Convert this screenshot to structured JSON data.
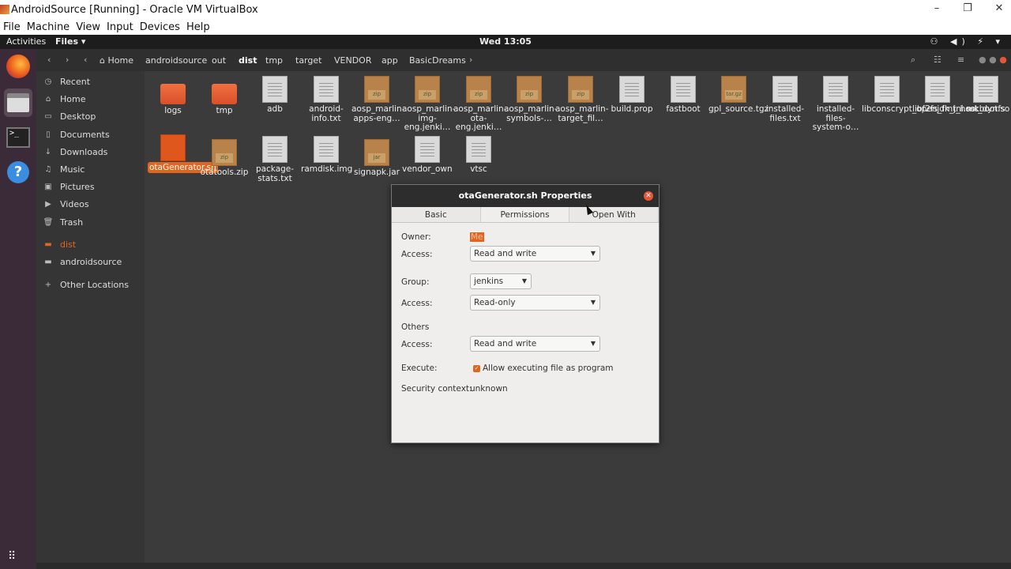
{
  "host": {
    "title": "AndroidSource [Running] - Oracle VM VirtualBox",
    "minimize": "–",
    "restore": "❐",
    "close": "✕",
    "menu": [
      "File",
      "Machine",
      "View",
      "Input",
      "Devices",
      "Help"
    ]
  },
  "topbar": {
    "activities": "Activities",
    "app_menu": "Files ▾",
    "clock": "Wed 13:05",
    "tray": "⚇ ◀) ⚡ ▾"
  },
  "sidebar": {
    "items": [
      {
        "icon": "clock-icon",
        "glyph": "◷",
        "label": "Recent"
      },
      {
        "icon": "home-icon",
        "glyph": "⌂",
        "label": "Home"
      },
      {
        "icon": "desktop-icon",
        "glyph": "▭",
        "label": "Desktop"
      },
      {
        "icon": "documents-icon",
        "glyph": "▯",
        "label": "Documents"
      },
      {
        "icon": "downloads-icon",
        "glyph": "↓",
        "label": "Downloads"
      },
      {
        "icon": "music-icon",
        "glyph": "♫",
        "label": "Music"
      },
      {
        "icon": "pictures-icon",
        "glyph": "▣",
        "label": "Pictures"
      },
      {
        "icon": "videos-icon",
        "glyph": "▶",
        "label": "Videos"
      },
      {
        "icon": "trash-icon",
        "glyph": "🗑",
        "label": "Trash"
      },
      {
        "icon": "folder-icon",
        "glyph": "▬",
        "label": "dist"
      },
      {
        "icon": "folder-icon",
        "glyph": "▬",
        "label": "androidsource"
      },
      {
        "icon": "plus-icon",
        "glyph": "+",
        "label": "Other Locations"
      }
    ]
  },
  "breadcrumb": [
    "Home",
    "androidsource",
    "out",
    "dist",
    "tmp",
    "target",
    "VENDOR",
    "app",
    "BasicDreams"
  ],
  "files": [
    {
      "name": "logs",
      "kind": "folder"
    },
    {
      "name": "tmp",
      "kind": "folder"
    },
    {
      "name": "adb",
      "kind": "doc"
    },
    {
      "name": "android-info.txt",
      "kind": "doc"
    },
    {
      "name": "aosp_marlin-apps-eng…",
      "kind": "pkg",
      "tag": "zip"
    },
    {
      "name": "aosp_marlin-img-eng.jenki…",
      "kind": "pkg",
      "tag": "zip"
    },
    {
      "name": "aosp_marlin-ota-eng.jenki…",
      "kind": "pkg",
      "tag": "zip"
    },
    {
      "name": "aosp_marlin-symbols-…",
      "kind": "pkg",
      "tag": "zip"
    },
    {
      "name": "aosp_marlin-target_fil…",
      "kind": "pkg",
      "tag": "zip"
    },
    {
      "name": "build.prop",
      "kind": "doc"
    },
    {
      "name": "fastboot",
      "kind": "doc"
    },
    {
      "name": "gpl_source.tgz",
      "kind": "pkg",
      "tag": "tar.gz"
    },
    {
      "name": "installed-files.txt",
      "kind": "doc"
    },
    {
      "name": "installed-files-system-o…",
      "kind": "doc"
    },
    {
      "name": "libconscrypt_openjdk_jni.so",
      "kind": "doc"
    },
    {
      "name": "libf2fs_fmt_host_dyn.so",
      "kind": "doc"
    },
    {
      "name": "mkbootfs",
      "kind": "doc"
    },
    {
      "name": "otaGenerator.sh",
      "kind": "script"
    },
    {
      "name": "otatools.zip",
      "kind": "pkg",
      "tag": "zip"
    },
    {
      "name": "package-stats.txt",
      "kind": "doc"
    },
    {
      "name": "ramdisk.img",
      "kind": "doc"
    },
    {
      "name": "signapk.jar",
      "kind": "pkg",
      "tag": "jar"
    },
    {
      "name": "vendor_owner_info.txt",
      "kind": "doc"
    },
    {
      "name": "vtsc",
      "kind": "doc"
    }
  ],
  "dialog": {
    "title": "otaGenerator.sh Properties",
    "close": "✕",
    "tabs": [
      "Basic",
      "Permissions",
      "Open With"
    ],
    "owner_label": "Owner:",
    "owner_value": "Me",
    "access_label": "Access:",
    "owner_access": "Read and write",
    "group_label": "Group:",
    "group_value": "jenkins",
    "group_access": "Read-only",
    "others_label": "Others",
    "others_access": "Read and write",
    "execute_label": "Execute:",
    "execute_text": "Allow executing file as program",
    "security_label": "Security context:",
    "security_value": "unknown"
  }
}
